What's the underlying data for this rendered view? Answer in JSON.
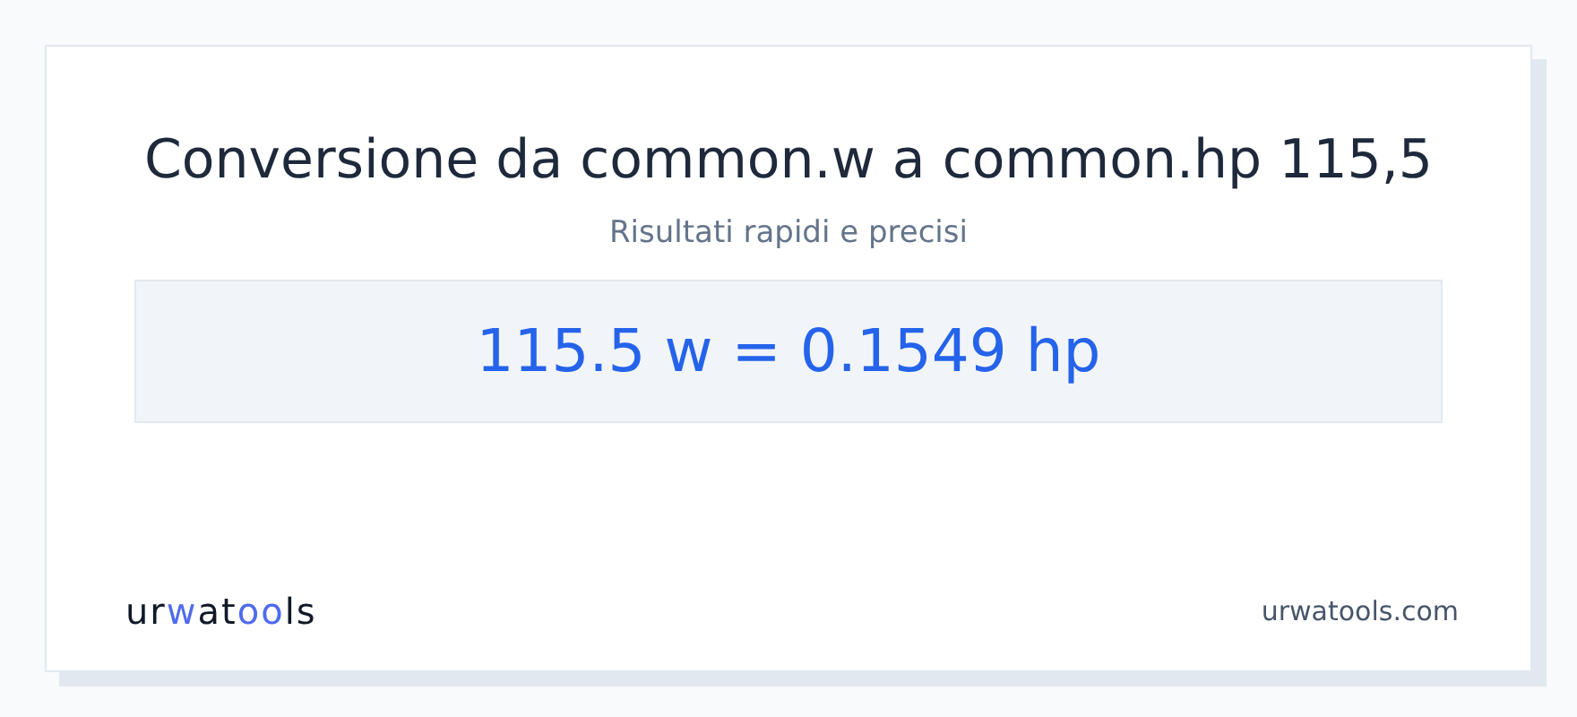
{
  "title": "Conversione da common.w a common.hp 115,5",
  "subtitle": "Risultati rapidi e precisi",
  "result": "115.5 w = 0.1549 hp",
  "logo": [
    {
      "text": "ur",
      "accent": false
    },
    {
      "text": "w",
      "accent": true
    },
    {
      "text": "at",
      "accent": false
    },
    {
      "text": "oo",
      "accent": true
    },
    {
      "text": "ls",
      "accent": false
    }
  ],
  "site": "urwatools.com"
}
